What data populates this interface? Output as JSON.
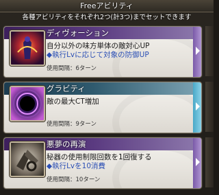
{
  "header": {
    "title": "Freeアビリティ",
    "subtitle": "各種アビリティをそれぞれ2つ(計3つ)までセットできます"
  },
  "abilities": [
    {
      "name": "ディヴォーション",
      "desc": "自分以外の味方単体の敵対心UP",
      "note": "◆執行Lvに応じて対象の防御UP",
      "cooldown": "使用間隔：6ターン",
      "icon": "devotion-icon",
      "theme": "purple"
    },
    {
      "name": "グラビティ",
      "desc": "敵の最大CT増加",
      "note": "",
      "cooldown": "使用間隔：9ターン",
      "icon": "gravity-icon",
      "theme": "blue"
    },
    {
      "name": "悪夢の再演",
      "desc": "秘器の使用制限回数を1回復する",
      "note": "◆執行Lvを10消費",
      "cooldown": "使用間隔：10ターン",
      "icon": "nightmare-reprise-icon",
      "theme": "purple"
    }
  ],
  "colors": {
    "purple_bar": "#5a3a80",
    "blue_bar": "#2f5a6e",
    "note_text": "#2b4fb5"
  }
}
